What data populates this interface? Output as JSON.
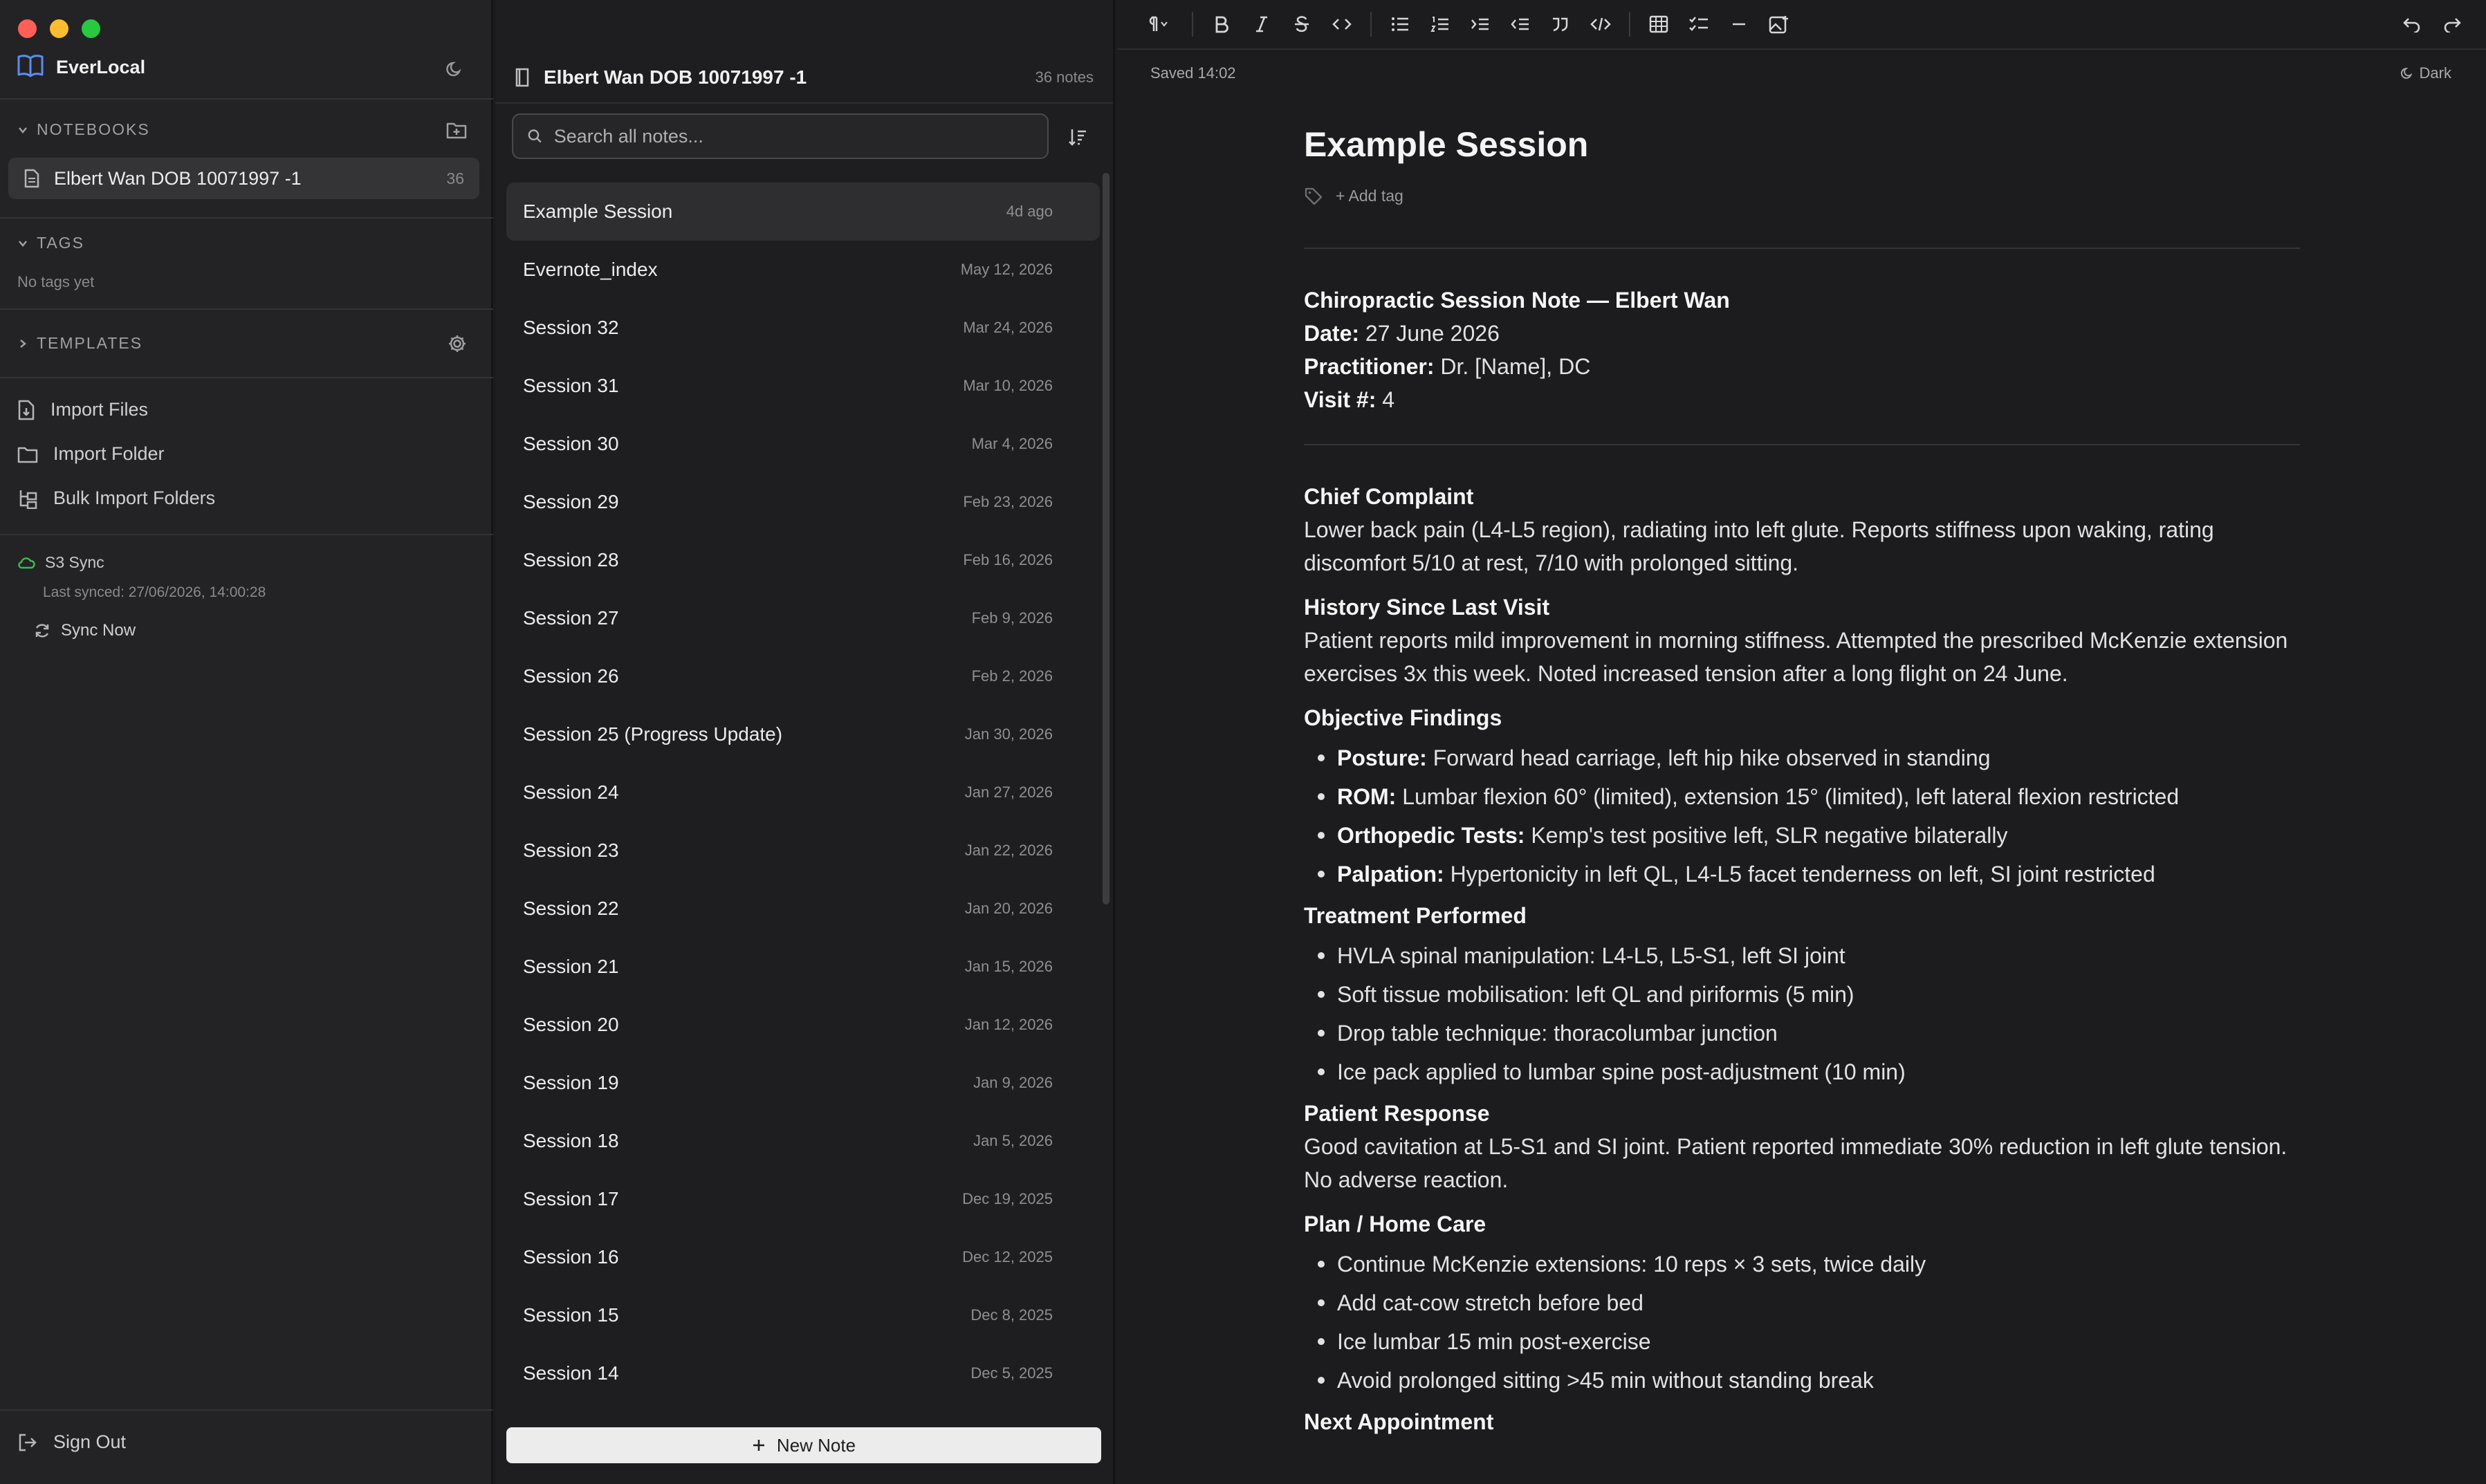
{
  "sidebar": {
    "app_name": "EverLocal",
    "notebooks_heading": "NOTEBOOKS",
    "notebook": {
      "label": "Elbert Wan DOB 10071997 -1",
      "count": "36"
    },
    "tags_heading": "TAGS",
    "no_tags": "No tags yet",
    "templates_heading": "TEMPLATES",
    "import_files": "Import Files",
    "import_folder": "Import Folder",
    "bulk_import": "Bulk Import Folders",
    "sync_title": "S3 Sync",
    "last_synced": "Last synced: 27/06/2026, 14:00:28",
    "sync_now": "Sync Now",
    "sign_out": "Sign Out"
  },
  "notelist": {
    "title": "Elbert Wan DOB 10071997 -1",
    "count": "36 notes",
    "search_placeholder": "Search all notes...",
    "new_note": "New Note",
    "notes": [
      {
        "title": "Example Session",
        "date": "4d ago"
      },
      {
        "title": "Evernote_index",
        "date": "May 12, 2026"
      },
      {
        "title": "Session 32",
        "date": "Mar 24, 2026"
      },
      {
        "title": "Session 31",
        "date": "Mar 10, 2026"
      },
      {
        "title": "Session 30",
        "date": "Mar 4, 2026"
      },
      {
        "title": "Session 29",
        "date": "Feb 23, 2026"
      },
      {
        "title": "Session 28",
        "date": "Feb 16, 2026"
      },
      {
        "title": "Session 27",
        "date": "Feb 9, 2026"
      },
      {
        "title": "Session 26",
        "date": "Feb 2, 2026"
      },
      {
        "title": "Session 25 (Progress Update)",
        "date": "Jan 30, 2026"
      },
      {
        "title": "Session 24",
        "date": "Jan 27, 2026"
      },
      {
        "title": "Session 23",
        "date": "Jan 22, 2026"
      },
      {
        "title": "Session 22",
        "date": "Jan 20, 2026"
      },
      {
        "title": "Session 21",
        "date": "Jan 15, 2026"
      },
      {
        "title": "Session 20",
        "date": "Jan 12, 2026"
      },
      {
        "title": "Session 19",
        "date": "Jan 9, 2026"
      },
      {
        "title": "Session 18",
        "date": "Jan 5, 2026"
      },
      {
        "title": "Session 17",
        "date": "Dec 19, 2025"
      },
      {
        "title": "Session 16",
        "date": "Dec 12, 2025"
      },
      {
        "title": "Session 15",
        "date": "Dec 8, 2025"
      },
      {
        "title": "Session 14",
        "date": "Dec 5, 2025"
      }
    ]
  },
  "editor": {
    "saved": "Saved 14:02",
    "theme": "Dark",
    "note_title": "Example Session",
    "add_tag": "+ Add tag",
    "header": {
      "title": "Chiropractic Session Note — Elbert Wan",
      "date_label": "Date:",
      "date_value": " 27 June 2026",
      "practitioner_label": "Practitioner:",
      "practitioner_value": " Dr. [Name], DC",
      "visit_label": "Visit #:",
      "visit_value": " 4"
    },
    "chief_complaint": {
      "heading": "Chief Complaint",
      "text": "Lower back pain (L4-L5 region), radiating into left glute. Reports stiffness upon waking, rating discomfort 5/10 at rest, 7/10 with prolonged sitting."
    },
    "history": {
      "heading": "History Since Last Visit",
      "text": "Patient reports mild improvement in morning stiffness. Attempted the prescribed McKenzie extension exercises 3x this week. Noted increased tension after a long flight on 24 June."
    },
    "objective": {
      "heading": "Objective Findings",
      "items": [
        {
          "label": "Posture:",
          "text": " Forward head carriage, left hip hike observed in standing"
        },
        {
          "label": "ROM:",
          "text": " Lumbar flexion 60° (limited), extension 15° (limited), left lateral flexion restricted"
        },
        {
          "label": "Orthopedic Tests:",
          "text": " Kemp's test positive left, SLR negative bilaterally"
        },
        {
          "label": "Palpation:",
          "text": " Hypertonicity in left QL, L4-L5 facet tenderness on left, SI joint restricted"
        }
      ]
    },
    "treatment": {
      "heading": "Treatment Performed",
      "items": [
        "HVLA spinal manipulation: L4-L5, L5-S1, left SI joint",
        "Soft tissue mobilisation: left QL and piriformis (5 min)",
        "Drop table technique: thoracolumbar junction",
        "Ice pack applied to lumbar spine post-adjustment (10 min)"
      ]
    },
    "response": {
      "heading": "Patient Response",
      "text": "Good cavitation at L5-S1 and SI joint. Patient reported immediate 30% reduction in left glute tension. No adverse reaction."
    },
    "plan": {
      "heading": "Plan / Home Care",
      "items": [
        "Continue McKenzie extensions: 10 reps × 3 sets, twice daily",
        "Add cat-cow stretch before bed",
        "Ice lumbar 15 min post-exercise",
        "Avoid prolonged sitting >45 min without standing break"
      ]
    },
    "next": {
      "heading": "Next Appointment"
    }
  },
  "colors": {
    "close": "#fe5f57",
    "minimize": "#febc2e",
    "maximize": "#28c840",
    "accent": "#5b8def",
    "sync_ok": "#3fb950"
  },
  "icons": [
    "book-icon",
    "moon-icon",
    "folder-plus-icon",
    "file-icon",
    "gear-icon",
    "file-import-icon",
    "folder-icon",
    "folder-tree-icon",
    "cloud-icon",
    "refresh-icon",
    "sign-out-icon",
    "search-icon",
    "sort-icon",
    "plus-icon",
    "tag-icon",
    "undo-icon",
    "redo-icon"
  ]
}
